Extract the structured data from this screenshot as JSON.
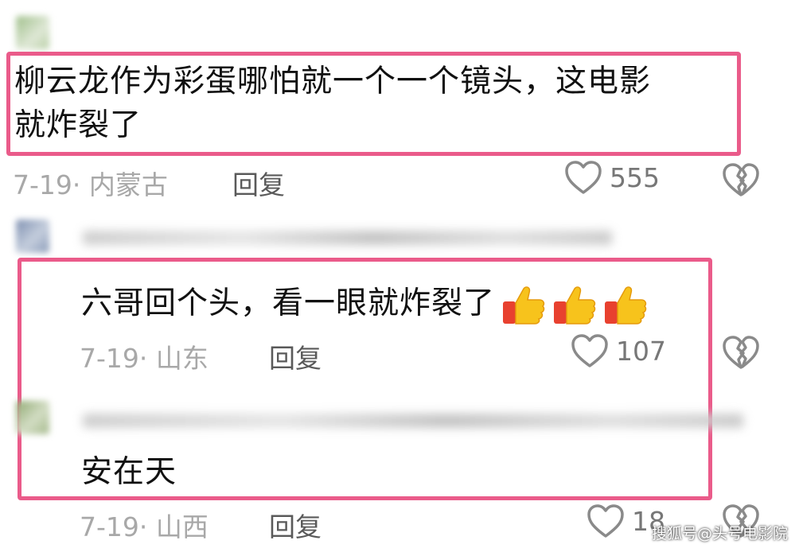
{
  "comments": [
    {
      "text_line1": "柳云龙作为彩蛋哪怕就一个一个镜头，这电影",
      "text_line2": "就炸裂了",
      "date_location": "7-19· 内蒙古",
      "reply_label": "回复",
      "like_count": "555"
    },
    {
      "text": "六哥回个头，看一眼就炸裂了",
      "emoji": [
        "thumbs-up",
        "thumbs-up",
        "thumbs-up"
      ],
      "date_location": "7-19· 山东",
      "reply_label": "回复",
      "like_count": "107"
    },
    {
      "text": "安在天",
      "date_location": "7-19· 山西",
      "reply_label": "回复",
      "like_count": "18"
    }
  ],
  "watermark": "搜狐号@头号电影院",
  "colors": {
    "highlight_border": "#ea5b8a",
    "meta_text": "#a8a8a8",
    "thumb_yellow": "#f7c31c",
    "thumb_sleeve": "#e8412f"
  },
  "icons": {
    "like": "heart-outline-icon",
    "dislike": "broken-heart-icon",
    "emoji": "thumbs-up-emoji"
  }
}
